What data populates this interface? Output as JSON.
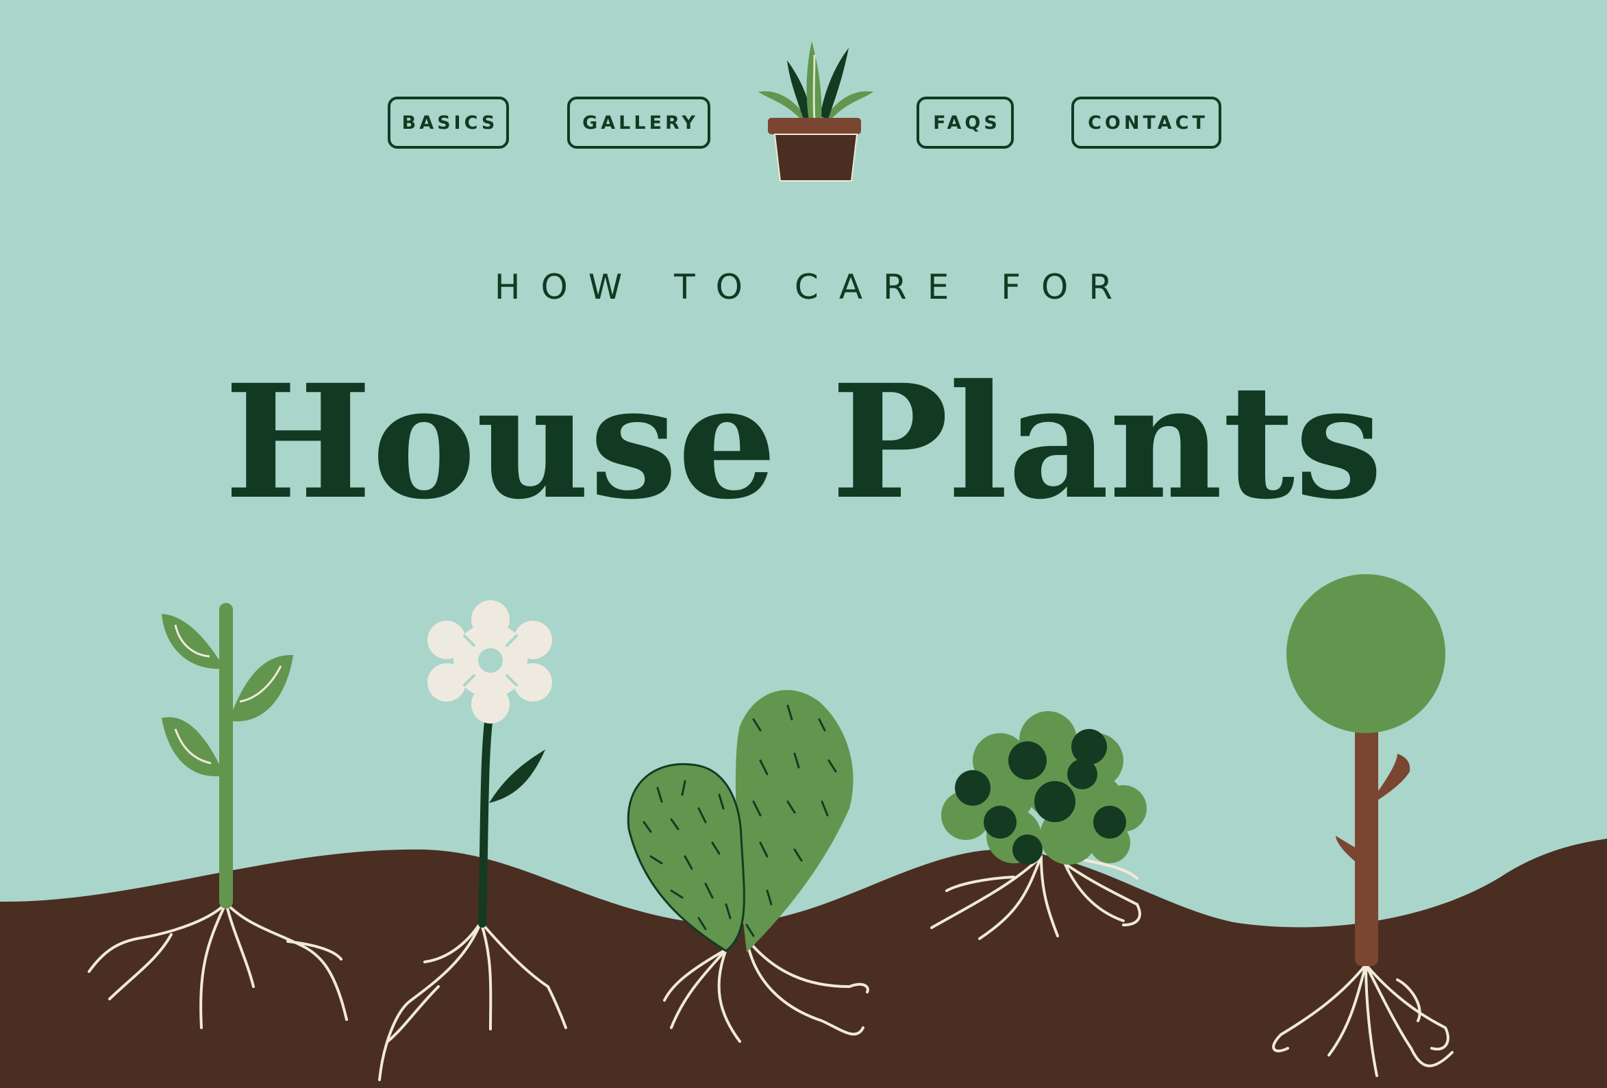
{
  "nav": {
    "basics_label": "BASICS",
    "gallery_label": "GALLERY",
    "faqs_label": "FAQS",
    "contact_label": "CONTACT"
  },
  "hero": {
    "subtitle": "HOW TO CARE FOR",
    "title": "House Plants"
  },
  "icons": {
    "logo": "potted-plant-icon",
    "plants": [
      "sprout-icon",
      "flower-icon",
      "cactus-icon",
      "bush-icon",
      "tree-icon"
    ]
  },
  "colors": {
    "background": "#aad5ca",
    "ink": "#123a22",
    "soil": "#4a2e22",
    "leaf": "#62964e",
    "dark_leaf": "#143a22",
    "root": "#f1ead8",
    "trunk": "#7a4631"
  }
}
